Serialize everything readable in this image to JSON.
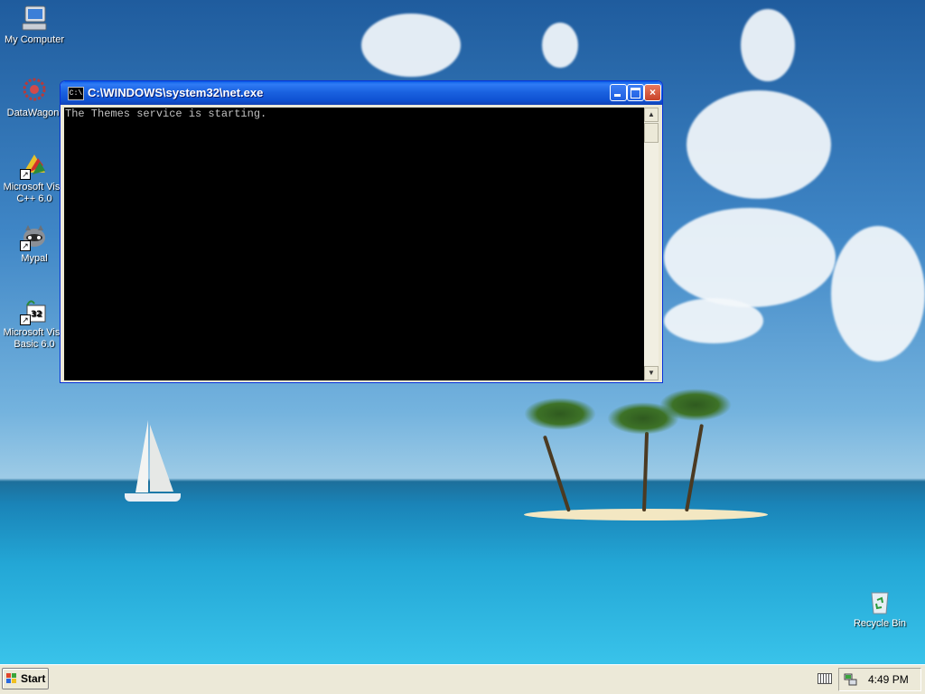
{
  "desktop": {
    "icons": [
      {
        "label": "My Computer",
        "icon": "my-computer-icon"
      },
      {
        "label": "DataWagon.",
        "icon": "datawagon-icon"
      },
      {
        "label": "Microsoft Visu C++ 6.0",
        "icon": "visual-cpp-icon"
      },
      {
        "label": "Mypal",
        "icon": "mypal-icon"
      },
      {
        "label": "Microsoft Visu Basic 6.0",
        "icon": "visual-basic-icon"
      },
      {
        "label": "Recycle Bin",
        "icon": "recycle-bin-icon"
      }
    ]
  },
  "window": {
    "title": "C:\\WINDOWS\\system32\\net.exe",
    "icon_text": "C:\\",
    "console_text": "The Themes service is starting.",
    "buttons": {
      "minimize": "minimize-icon",
      "maximize": "maximize-icon",
      "close": "×"
    }
  },
  "taskbar": {
    "start_label": "Start",
    "clock": "4:49 PM"
  },
  "colors": {
    "titlebar": "#0f52d3",
    "console_bg": "#000000",
    "console_fg": "#c0c0c0",
    "taskbar": "#ece9d8"
  }
}
